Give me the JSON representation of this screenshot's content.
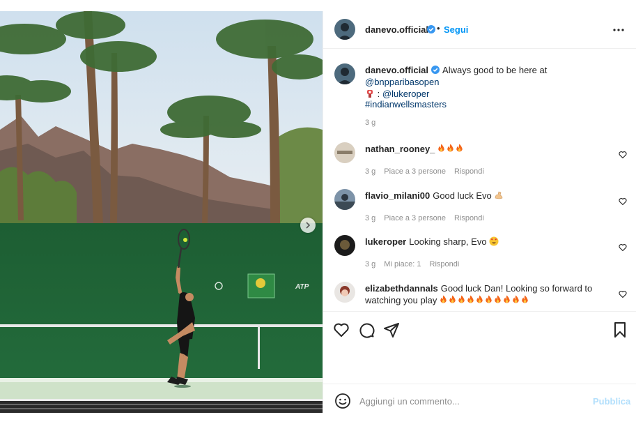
{
  "post": {
    "author": "danevo.official",
    "separator": "•",
    "follow_label": "Segui"
  },
  "caption": {
    "username": "danevo.official",
    "text": "Always good to be here at",
    "mention_bnp": "@bnpparibasopen",
    "photo_prefix": ":",
    "mention_photographer": "@lukeroper",
    "hashtag": "#indianwellsmasters",
    "time": "3 g"
  },
  "comments": [
    {
      "username": "nathan_rooney_",
      "text": "",
      "flames": 3,
      "time": "3 g",
      "likes": "Piace a 3 persone",
      "reply": "Rispondi"
    },
    {
      "username": "flavio_milani00",
      "text": "Good luck Evo",
      "time": "3 g",
      "likes": "Piace a 3 persone",
      "reply": "Rispondi"
    },
    {
      "username": "lukeroper",
      "text": "Looking sharp, Evo",
      "time": "3 g",
      "likes": "Mi piace: 1",
      "reply": "Rispondi"
    },
    {
      "username": "elizabethdannals",
      "text": "Good luck Dan! Looking so forward to watching you play",
      "flames": 10
    }
  ],
  "composer": {
    "placeholder": "Aggiungi un commento...",
    "publish_label": "Pubblica"
  },
  "media": {
    "court_sign_atp": "ATP"
  },
  "colors": {
    "link": "#0095f6",
    "verified": "#3897f0",
    "muted": "#8e8e8e",
    "court_green": "#1f6a38"
  }
}
